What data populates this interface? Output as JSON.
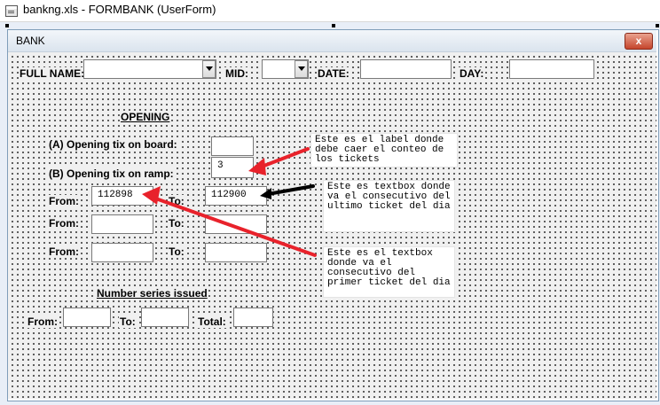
{
  "window": {
    "title": "bankng.xls - FORMBANK (UserForm)"
  },
  "form": {
    "caption": "BANK",
    "close_label": "x",
    "full_name_label": "FULL NAME:",
    "mid_label": "MID:",
    "date_label": "DATE:",
    "day_label": "DAY:",
    "opening_heading": "OPENING",
    "on_board_label": "(A) Opening tix on board:",
    "on_ramp_label": "(B) Opening tix on ramp:",
    "on_ramp_value": "3",
    "rows": [
      {
        "from_label": "From:",
        "from_value": "112898",
        "to_label": "To:",
        "to_value": "112900"
      },
      {
        "from_label": "From:",
        "from_value": "",
        "to_label": "To:",
        "to_value": ""
      },
      {
        "from_label": "From:",
        "from_value": "",
        "to_label": "To:",
        "to_value": ""
      }
    ],
    "series_heading": "Number series issued",
    "series_from_label": "From:",
    "series_to_label": "To:",
    "series_total_label": "Total:"
  },
  "notes": [
    "Este es el label donde debe caer el conteo de los tickets",
    "Este es textbox donde va el consecutivo del ultimo ticket del dia",
    "Este es el textbox donde va el consecutivo del primer ticket del dia"
  ],
  "colors": {
    "arrow_red": "#e8222b",
    "arrow_black": "#000000",
    "grid_dot": "#3a3a3a"
  }
}
